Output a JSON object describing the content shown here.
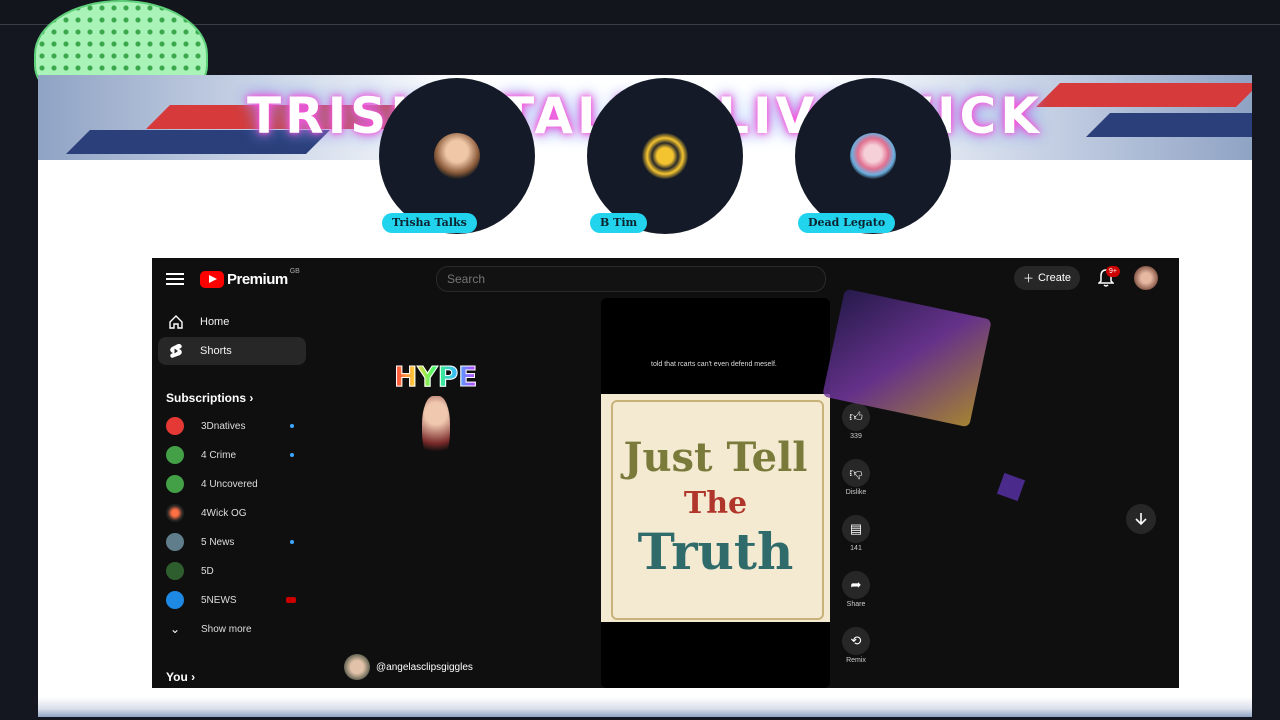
{
  "banner": {
    "title": "TRISHA TALKS LIVE WICK"
  },
  "guests": [
    {
      "name": "Trisha Talks"
    },
    {
      "name": "B Tim"
    },
    {
      "name": "Dead Legato"
    }
  ],
  "yt": {
    "logo_text": "Premium",
    "logo_sup": "GB",
    "search": {
      "placeholder": "Search"
    },
    "create_label": "Create",
    "notif_count": "9+",
    "sidebar": {
      "home": "Home",
      "shorts": "Shorts",
      "subscriptions_title": "Subscriptions",
      "subscriptions": [
        {
          "name": "3Dnatives",
          "color": "#e53935"
        },
        {
          "name": "4 Crime",
          "color": "#43a047"
        },
        {
          "name": "4 Uncovered",
          "color": "#43a047"
        },
        {
          "name": "4Wick OG",
          "color": "#222222"
        },
        {
          "name": "5 News",
          "color": "#607d8b"
        },
        {
          "name": "5D",
          "color": "#2e5d2e"
        },
        {
          "name": "5NEWS",
          "color": "#1e88e5"
        }
      ],
      "show_more": "Show more",
      "you": "You"
    },
    "short": {
      "caption": "told that rcarts can't even defend meself.",
      "scroll_line1": "Just Tell",
      "scroll_line2": "The",
      "scroll_line3": "Truth",
      "channel_handle": "@angelasclipsgiggles"
    },
    "actions": {
      "like_count": "339",
      "dislike": "Dislike",
      "comments_count": "141",
      "share": "Share",
      "remix": "Remix"
    },
    "hype_sticker": "HYPE"
  }
}
